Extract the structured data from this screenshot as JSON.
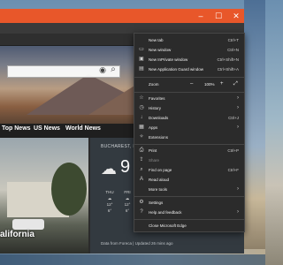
{
  "colors": {
    "titlebar": "#e8572a",
    "menu_bg": "#2b2b2b",
    "accent": "#e8572a"
  },
  "window": {
    "controls": {
      "minimize": "–",
      "maximize": "☐",
      "close": "✕"
    },
    "more_button": "···"
  },
  "toolbar_icons": [
    "star-icon",
    "reading-list-icon",
    "more-icon"
  ],
  "news_nav": [
    "Top News",
    "US News",
    "World News"
  ],
  "article": {
    "title": "alifornia"
  },
  "weather": {
    "location": "BUCHAREST, RO",
    "temperature": "9",
    "days": [
      {
        "name": "THU",
        "hi": "12°",
        "lo": "6°"
      },
      {
        "name": "FRI",
        "hi": "12°",
        "lo": "6°"
      }
    ],
    "footer": "Data from Foreca | Updated 26 mins ago"
  },
  "menu": {
    "items": [
      {
        "label": "New tab",
        "shortcut": "Ctrl+T",
        "icon": ""
      },
      {
        "label": "New window",
        "shortcut": "Ctrl+N",
        "icon": "window-icon"
      },
      {
        "label": "New InPrivate window",
        "shortcut": "Ctrl+Shift+N",
        "icon": "inprivate-icon"
      },
      {
        "label": "New Application Guard window",
        "shortcut": "Ctrl+Shift+A",
        "icon": "app-guard-icon"
      },
      {
        "label": "Zoom",
        "value": "100%",
        "minus": "–",
        "plus": "+",
        "expand": "⤢"
      },
      {
        "label": "Favorites",
        "icon": "favorites-icon"
      },
      {
        "label": "History",
        "icon": "history-icon"
      },
      {
        "label": "Downloads",
        "shortcut": "Ctrl+J",
        "icon": "download-icon"
      },
      {
        "label": "Apps",
        "icon": "apps-icon"
      },
      {
        "label": "Extensions",
        "icon": "extensions-icon"
      },
      {
        "label": "Print",
        "shortcut": "Ctrl+P",
        "icon": "print-icon"
      },
      {
        "label": "Share",
        "icon": "share-icon"
      },
      {
        "label": "Find on page",
        "shortcut": "Ctrl+F",
        "icon": "find-icon"
      },
      {
        "label": "Read aloud",
        "icon": "read-aloud-icon"
      },
      {
        "label": "More tools",
        "icon": ""
      },
      {
        "label": "Settings",
        "icon": "gear-icon"
      },
      {
        "label": "Help and feedback",
        "icon": "help-icon"
      },
      {
        "label": "Close Microsoft Edge",
        "icon": ""
      }
    ]
  }
}
